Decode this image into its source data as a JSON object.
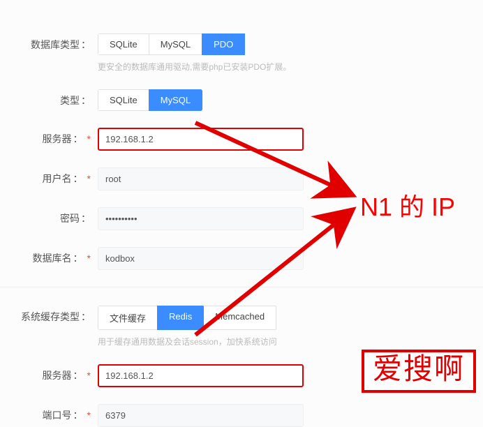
{
  "db_type": {
    "label": "数据库类型",
    "options": [
      "SQLite",
      "MySQL",
      "PDO"
    ],
    "selected": "PDO",
    "hint": "更安全的数据库通用驱动,需要php已安装PDO扩展。"
  },
  "type": {
    "label": "类型",
    "options": [
      "SQLite",
      "MySQL"
    ],
    "selected": "MySQL"
  },
  "server": {
    "label": "服务器",
    "value": "192.168.1.2"
  },
  "username": {
    "label": "用户名",
    "value": "root"
  },
  "password": {
    "label": "密码",
    "value": "••••••••••"
  },
  "dbname": {
    "label": "数据库名",
    "value": "kodbox"
  },
  "cache_type": {
    "label": "系统缓存类型",
    "options": [
      "文件缓存",
      "Redis",
      "Memcached"
    ],
    "selected": "Redis",
    "hint": "用于缓存通用数据及会话session，加快系统访问"
  },
  "cache_server": {
    "label": "服务器",
    "value": "192.168.1.2"
  },
  "port": {
    "label": "端口号",
    "value": "6379"
  },
  "annotation": "N1 的 IP",
  "watermark": "爱搜啊"
}
